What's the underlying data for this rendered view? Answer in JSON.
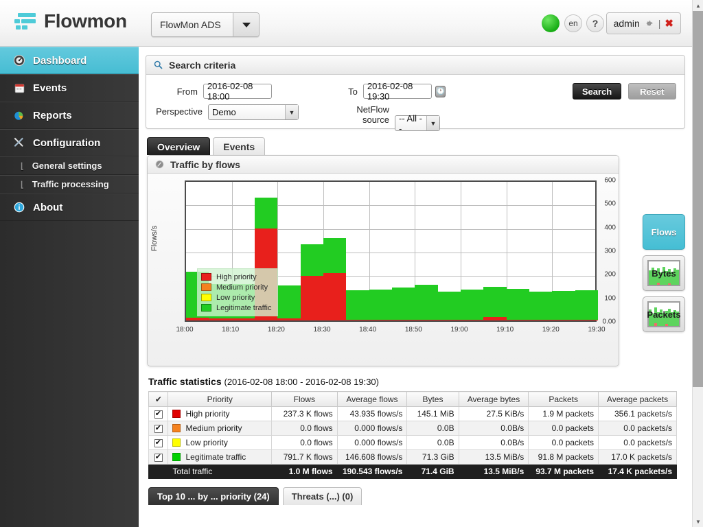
{
  "header": {
    "brand": "Flowmon",
    "module": "FlowMon ADS",
    "lang": "en",
    "help": "?",
    "user": "admin",
    "separator": "|",
    "close": "✖"
  },
  "sidebar": {
    "items": [
      {
        "label": "Dashboard",
        "icon": "gauge-icon",
        "active": true,
        "sub": false
      },
      {
        "label": "Events",
        "icon": "calendar-icon",
        "active": false,
        "sub": false
      },
      {
        "label": "Reports",
        "icon": "pie-chart-icon",
        "active": false,
        "sub": false
      },
      {
        "label": "Configuration",
        "icon": "tools-icon",
        "active": false,
        "sub": false
      },
      {
        "label": "General settings",
        "icon": "branch-icon",
        "active": false,
        "sub": true
      },
      {
        "label": "Traffic processing",
        "icon": "branch-icon",
        "active": false,
        "sub": true
      },
      {
        "label": "About",
        "icon": "info-icon",
        "active": false,
        "sub": false
      }
    ]
  },
  "search_criteria": {
    "panel_title": "Search criteria",
    "from_label": "From",
    "from_value": "2016-02-08 18:00",
    "to_label": "To",
    "to_value": "2016-02-08 19:30",
    "perspective_label": "Perspective",
    "perspective_value": "Demo",
    "netflow_label_1": "NetFlow",
    "netflow_label_2": "source",
    "netflow_value": "-- All --",
    "search_button": "Search",
    "reset_button": "Reset"
  },
  "tabs": [
    {
      "label": "Overview",
      "active": true
    },
    {
      "label": "Events",
      "active": false
    }
  ],
  "chart_panel": {
    "title": "Traffic by flows"
  },
  "metric_buttons": [
    {
      "label": "Flows",
      "active": true
    },
    {
      "label": "Bytes",
      "active": false
    },
    {
      "label": "Packets",
      "active": false
    }
  ],
  "chart_data": {
    "type": "bar",
    "title": "Traffic by flows",
    "xlabel": "",
    "ylabel": "Flows/s",
    "ylim": [
      0,
      600
    ],
    "yticks": [
      "0.00",
      "100",
      "200",
      "300",
      "400",
      "500",
      "600"
    ],
    "ytick_values": [
      0,
      100,
      200,
      300,
      400,
      500,
      600
    ],
    "xticks": [
      "18:00",
      "18:10",
      "18:20",
      "18:30",
      "18:40",
      "18:50",
      "19:00",
      "19:10",
      "19:20",
      "19:30"
    ],
    "xtick_values": [
      0,
      10,
      20,
      30,
      40,
      50,
      60,
      70,
      80,
      90
    ],
    "grid": true,
    "stacked": true,
    "legend_position": "inside-bottom-left",
    "series": [
      {
        "name": "High priority",
        "color": "#e8201c",
        "values": [
          12,
          10,
          8,
          390,
          10,
          190,
          202,
          4,
          3,
          3,
          3,
          3,
          3,
          14,
          3,
          3,
          3,
          3
        ]
      },
      {
        "name": "Medium priority",
        "color": "#f5821f",
        "values": [
          0,
          0,
          0,
          0,
          0,
          0,
          0,
          0,
          0,
          0,
          0,
          0,
          0,
          0,
          0,
          0,
          0,
          0
        ]
      },
      {
        "name": "Low priority",
        "color": "#ffff00",
        "values": [
          0,
          0,
          0,
          0,
          0,
          0,
          0,
          0,
          0,
          0,
          0,
          0,
          0,
          0,
          0,
          0,
          0,
          0
        ]
      },
      {
        "name": "Legitimate traffic",
        "color": "#22cc22",
        "values": [
          194,
          145,
          147,
          132,
          138,
          134,
          148,
          125,
          128,
          138,
          148,
          120,
          128,
          128,
          130,
          119,
          123,
          124
        ]
      }
    ],
    "bins": [
      "18:00",
      "18:05",
      "18:10",
      "18:15",
      "18:20",
      "18:25",
      "18:30",
      "18:35",
      "18:40",
      "18:45",
      "18:50",
      "18:55",
      "19:00",
      "19:05",
      "19:10",
      "19:15",
      "19:20",
      "19:25"
    ],
    "bin_totals": [
      206,
      155,
      155,
      522,
      148,
      324,
      350,
      129,
      131,
      141,
      151,
      123,
      131,
      142,
      133,
      122,
      126,
      127
    ]
  },
  "legend": [
    {
      "label": "High priority",
      "color": "#e8201c"
    },
    {
      "label": "Medium priority",
      "color": "#f5821f"
    },
    {
      "label": "Low priority",
      "color": "#ffff00"
    },
    {
      "label": "Legitimate traffic",
      "color": "#22cc22"
    }
  ],
  "stats": {
    "title": "Traffic statistics",
    "range": "(2016-02-08 18:00 - 2016-02-08 19:30)",
    "columns": [
      "✔",
      "Priority",
      "Flows",
      "Average flows",
      "Bytes",
      "Average bytes",
      "Packets",
      "Average packets"
    ],
    "rows": [
      {
        "checked": true,
        "color": "#e00000",
        "priority": "High priority",
        "flows": "237.3 K flows",
        "avg_flows": "43.935 flows/s",
        "bytes": "145.1 MiB",
        "avg_bytes": "27.5 KiB/s",
        "packets": "1.9 M packets",
        "avg_packets": "356.1 packets/s"
      },
      {
        "checked": true,
        "color": "#f5821f",
        "priority": "Medium priority",
        "flows": "0.0 flows",
        "avg_flows": "0.000 flows/s",
        "bytes": "0.0B",
        "avg_bytes": "0.0B/s",
        "packets": "0.0 packets",
        "avg_packets": "0.0 packets/s"
      },
      {
        "checked": true,
        "color": "#ffff00",
        "priority": "Low priority",
        "flows": "0.0 flows",
        "avg_flows": "0.000 flows/s",
        "bytes": "0.0B",
        "avg_bytes": "0.0B/s",
        "packets": "0.0 packets",
        "avg_packets": "0.0 packets/s"
      },
      {
        "checked": true,
        "color": "#00d000",
        "priority": "Legitimate traffic",
        "flows": "791.7 K flows",
        "avg_flows": "146.608 flows/s",
        "bytes": "71.3 GiB",
        "avg_bytes": "13.5 MiB/s",
        "packets": "91.8 M packets",
        "avg_packets": "17.0 K packets/s"
      }
    ],
    "total": {
      "priority": "Total traffic",
      "flows": "1.0 M flows",
      "avg_flows": "190.543 flows/s",
      "bytes": "71.4 GiB",
      "avg_bytes": "13.5 MiB/s",
      "packets": "93.7 M packets",
      "avg_packets": "17.4 K packets/s"
    }
  },
  "bottom_tabs": [
    {
      "label": "Top 10 ... by ... priority (24)",
      "active": true
    },
    {
      "label": "Threats (...) (0)",
      "active": false
    }
  ],
  "colors": {
    "accent": "#46bdd3",
    "high": "#e8201c",
    "medium": "#f5821f",
    "low": "#ffff00",
    "legit": "#22cc22"
  }
}
